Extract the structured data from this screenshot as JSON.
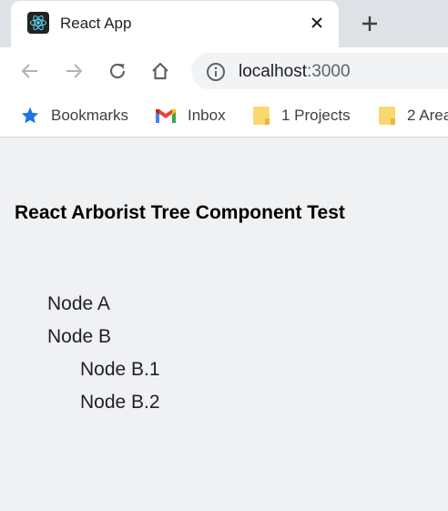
{
  "browser": {
    "tab_title": "React App",
    "url_host": "localhost",
    "url_port": ":3000"
  },
  "bookmarks": [
    {
      "label": "Bookmarks",
      "icon": "star-icon"
    },
    {
      "label": "Inbox",
      "icon": "gmail-icon"
    },
    {
      "label": "1 Projects",
      "icon": "folder-icon"
    },
    {
      "label": "2 Area",
      "icon": "folder-icon"
    }
  ],
  "page": {
    "title": "React Arborist Tree Component Test",
    "tree": [
      {
        "label": "Node A",
        "depth": 0
      },
      {
        "label": "Node B",
        "depth": 0
      },
      {
        "label": "Node B.1",
        "depth": 1
      },
      {
        "label": "Node B.2",
        "depth": 1
      }
    ]
  },
  "colors": {
    "page_bg": "#f0f1f3",
    "tabstrip_bg": "#dee1e6",
    "star": "#1a73e8",
    "folder": "#f9d96e"
  }
}
